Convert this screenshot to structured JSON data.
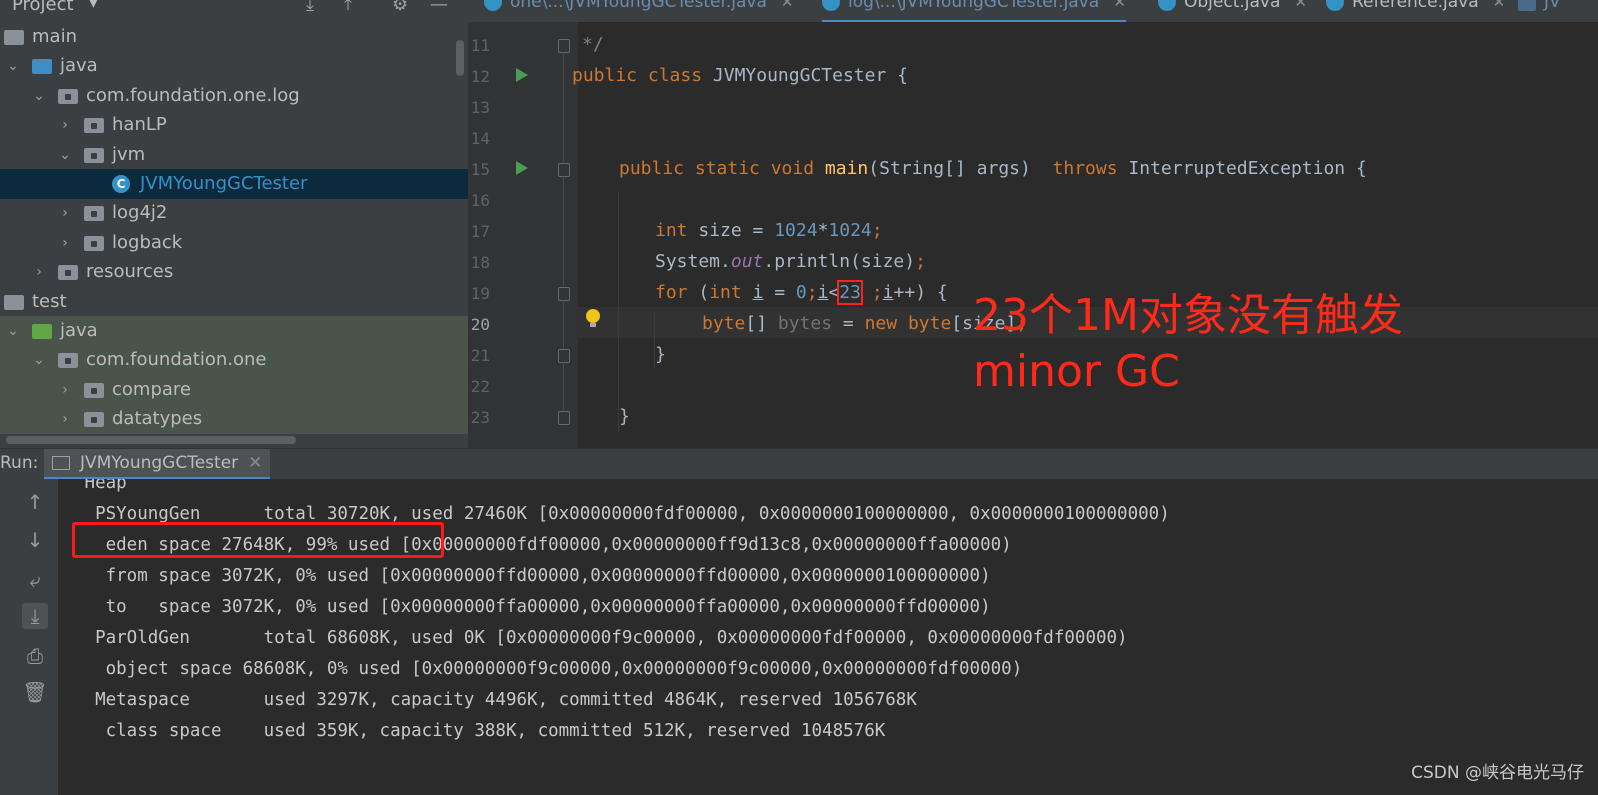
{
  "project": {
    "title": "Project",
    "tree": [
      {
        "label": "main",
        "level": 0,
        "arrow": "",
        "icon": "folder-gray"
      },
      {
        "label": "java",
        "level": 1,
        "arrow": "down",
        "icon": "folder-blue"
      },
      {
        "label": "com.foundation.one.log",
        "level": 2,
        "arrow": "down",
        "icon": "package"
      },
      {
        "label": "hanLP",
        "level": 3,
        "arrow": "right",
        "icon": "package"
      },
      {
        "label": "jvm",
        "level": 3,
        "arrow": "down",
        "icon": "package"
      },
      {
        "label": "JVMYoungGCTester",
        "level": 4,
        "arrow": "",
        "icon": "class",
        "selected": true
      },
      {
        "label": "log4j2",
        "level": 3,
        "arrow": "right",
        "icon": "package"
      },
      {
        "label": "logback",
        "level": 3,
        "arrow": "right",
        "icon": "package"
      },
      {
        "label": "resources",
        "level": 2,
        "arrow": "right",
        "icon": "package"
      },
      {
        "label": "test",
        "level": 0,
        "arrow": "",
        "icon": "folder-gray"
      },
      {
        "label": "java",
        "level": 1,
        "arrow": "down",
        "icon": "folder-green",
        "green": true
      },
      {
        "label": "com.foundation.one",
        "level": 2,
        "arrow": "down",
        "icon": "package",
        "green": true
      },
      {
        "label": "compare",
        "level": 3,
        "arrow": "right",
        "icon": "package",
        "green": true
      },
      {
        "label": "datatypes",
        "level": 3,
        "arrow": "right",
        "icon": "package",
        "green": true
      }
    ]
  },
  "tabs": [
    {
      "label": "one\\...\\JVMYoungGCTester.java",
      "dim": true
    },
    {
      "label": "log\\...\\JVMYoungGCTester.java",
      "selected": true,
      "dim": true
    },
    {
      "label": "Object.java"
    },
    {
      "label": "Reference.java"
    },
    {
      "label": "JV"
    }
  ],
  "editor": {
    "line_numbers": [
      "11",
      "12",
      "13",
      "14",
      "15",
      "16",
      "17",
      "18",
      "19",
      "20",
      "21",
      "22",
      "23"
    ],
    "current_line": "20",
    "code": {
      "l11": "*/",
      "l12_kw1": "public",
      "l12_kw2": "class",
      "l12_name": "JVMYoungGCTester {",
      "l15_kw": "public static void",
      "l15_fn": "main",
      "l15_params": "(String[] args)",
      "l15_throws": "throws",
      "l15_exc": "InterruptedException {",
      "l17_kw": "int",
      "l17_var": "size = ",
      "l17_n1": "1024",
      "l17_op": "*",
      "l17_n2": "1024",
      "l17_semi": ";",
      "l18_a": "System.",
      "l18_fld": "out",
      "l18_b": ".println(size)",
      "l18_semi": ";",
      "l19_kw1": "for",
      "l19_a": " (",
      "l19_kw2": "int",
      "l19_i": "i",
      "l19_eq": " = ",
      "l19_zero": "0",
      "l19_semi1": ";",
      "l19_i2": "i",
      "l19_lt": "<",
      "l19_num": "23",
      "l19_semi2": " ;",
      "l19_i3": "i",
      "l19_end": "++) {",
      "l20_kw1": "byte",
      "l20_a": "[] ",
      "l20_unused": "bytes",
      "l20_eq": " = ",
      "l20_kw2": "new",
      "l20_kw3": "byte",
      "l20_b": "[size]",
      "l20_semi": ";",
      "l21": "}",
      "l23": "}"
    },
    "annotation_line1": "23个1M对象没有触发",
    "annotation_line2": "minor GC"
  },
  "run": {
    "label": "Run:",
    "tab": "JVMYoungGCTester",
    "console": [
      " Heap",
      "  PSYoungGen      total 30720K, used 27460K [0x00000000fdf00000, 0x0000000100000000, 0x0000000100000000)",
      "   eden space 27648K, 99% used [0x00000000fdf00000,0x00000000ff9d13c8,0x00000000ffa00000)",
      "   from space 3072K, 0% used [0x00000000ffd00000,0x00000000ffd00000,0x0000000100000000)",
      "   to   space 3072K, 0% used [0x00000000ffa00000,0x00000000ffa00000,0x00000000ffd00000)",
      "  ParOldGen       total 68608K, used 0K [0x00000000f9c00000, 0x00000000fdf00000, 0x00000000fdf00000)",
      "   object space 68608K, 0% used [0x00000000f9c00000,0x00000000f9c00000,0x00000000fdf00000)",
      "  Metaspace       used 3297K, capacity 4496K, committed 4864K, reserved 1056768K",
      "   class space    used 359K, capacity 388K, committed 512K, reserved 1048576K"
    ]
  },
  "watermark": "CSDN @峡谷电光马仔",
  "colors": {
    "keyword": "#cc7832",
    "number": "#6897bb",
    "function": "#ffc66d",
    "annotation": "#ff2a1a",
    "highlight_box": "#ff1a1a"
  }
}
